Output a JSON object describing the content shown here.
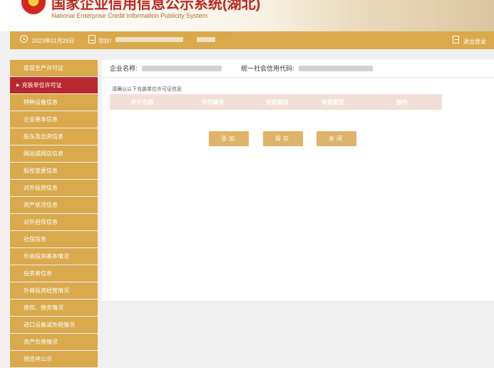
{
  "header": {
    "title": "国家企业信用信息公示系统(湖北)",
    "subtitle": "National Enterprise Credit Information Publicity System"
  },
  "topbar": {
    "date": "2023年01月29日",
    "greeting": "您好!",
    "logout": "退出登录"
  },
  "sidebar": {
    "items": [
      {
        "label": "疫苗生产许可证"
      },
      {
        "label": "充装单位许可证",
        "active": true
      },
      {
        "label": "特种设备信息"
      },
      {
        "label": "企业基本信息"
      },
      {
        "label": "股东及出资信息"
      },
      {
        "label": "网站或网店信息"
      },
      {
        "label": "股权变更信息"
      },
      {
        "label": "对外投资信息"
      },
      {
        "label": "资产状况信息"
      },
      {
        "label": "对外担保信息"
      },
      {
        "label": "社保信息"
      },
      {
        "label": "外商投资基本情况"
      },
      {
        "label": "投资者信息"
      },
      {
        "label": "外商投资经营情况"
      },
      {
        "label": "债权、债务情况"
      },
      {
        "label": "进口设备减免税情况"
      },
      {
        "label": "资产负债情况"
      },
      {
        "label": "预览并公示"
      }
    ]
  },
  "main": {
    "company_label": "企业名称:",
    "credit_code_label": "统一社会信用代码:",
    "notice": "请确认以下充装单位许可证信息",
    "table": {
      "headers": [
        "许可名称",
        "许可编号",
        "有效期自",
        "有效期至",
        "操作"
      ]
    },
    "buttons": {
      "add": "添加",
      "save": "保存",
      "close": "关闭"
    }
  },
  "colors": {
    "gold": "#d9a94c",
    "active_red": "#b8282e",
    "title_red": "#c0281c",
    "table_header": "#f0dfd6",
    "button": "#dfb468"
  }
}
